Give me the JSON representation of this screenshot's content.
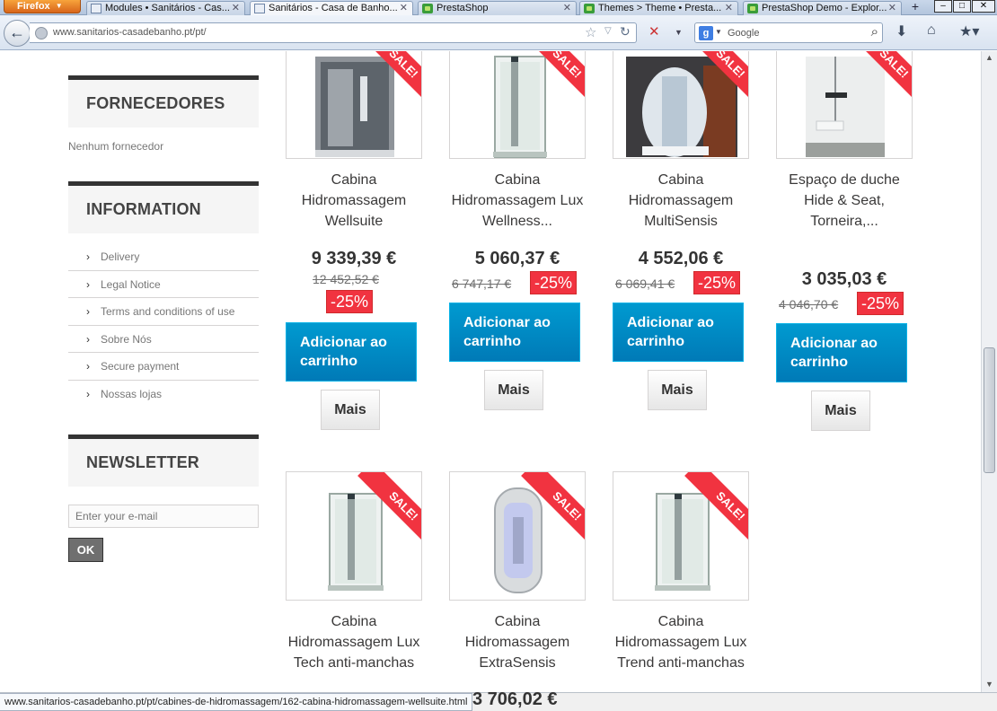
{
  "browser": {
    "app_button": "Firefox",
    "tabs": [
      {
        "label": "Modules • Sanitários - Cas...",
        "active": false
      },
      {
        "label": "Sanitários - Casa de Banho...",
        "active": true
      },
      {
        "label": "PrestaShop",
        "active": false
      },
      {
        "label": "Themes > Theme • Presta...",
        "active": false
      },
      {
        "label": "PrestaShop Demo - Explor...",
        "active": false
      }
    ],
    "address": "www.sanitarios-casadebanho.pt/pt/",
    "search_engine": "Google",
    "search_placeholder": "Google",
    "status_url": "www.sanitarios-casadebanho.pt/pt/cabines-de-hidromassagem/162-cabina-hidromassagem-wellsuite.html"
  },
  "sidebar": {
    "suppliers": {
      "title": "Fornecedores",
      "empty_text": "Nenhum fornecedor"
    },
    "information": {
      "title": "Information",
      "links": [
        "Delivery",
        "Legal Notice",
        "Terms and conditions of use",
        "Sobre Nós",
        "Secure payment",
        "Nossas lojas"
      ]
    },
    "newsletter": {
      "title": "Newsletter",
      "placeholder": "Enter your e-mail",
      "submit": "OK"
    }
  },
  "products": [
    {
      "name": "Cabina Hidromassagem Wellsuite",
      "price": "9 339,39 €",
      "old_price": "12 452,52 €",
      "reduction": "-25%",
      "sale_label": "Sale!",
      "cart_button": "Adicionar ao carrinho",
      "more_button": "Mais"
    },
    {
      "name": "Cabina Hidromassagem Lux Wellness...",
      "price": "5 060,37 €",
      "old_price": "6 747,17 €",
      "reduction": "-25%",
      "sale_label": "Sale!",
      "cart_button": "Adicionar ao carrinho",
      "more_button": "Mais"
    },
    {
      "name": "Cabina Hidromassagem MultiSensis",
      "price": "4 552,06 €",
      "old_price": "6 069,41 €",
      "reduction": "-25%",
      "sale_label": "Sale!",
      "cart_button": "Adicionar ao carrinho",
      "more_button": "Mais"
    },
    {
      "name": "Espaço de duche Hide & Seat, Torneira,...",
      "price": "3 035,03 €",
      "old_price": "4 046,70 €",
      "reduction": "-25%",
      "sale_label": "Sale!",
      "cart_button": "Adicionar ao carrinho",
      "more_button": "Mais"
    },
    {
      "name": "Cabina Hidromassagem Lux Tech anti-manchas",
      "sale_label": "Sale!"
    },
    {
      "name": "Cabina Hidromassagem ExtraSensis",
      "price": "3 706,02 €",
      "sale_label": "Sale!"
    },
    {
      "name": "Cabina Hidromassagem Lux Trend anti-manchas",
      "sale_label": "Sale!"
    }
  ],
  "colors": {
    "sale_red": "#f13340",
    "cart_blue": "#0084c4",
    "sidebar_bg": "#f5f5f5"
  }
}
